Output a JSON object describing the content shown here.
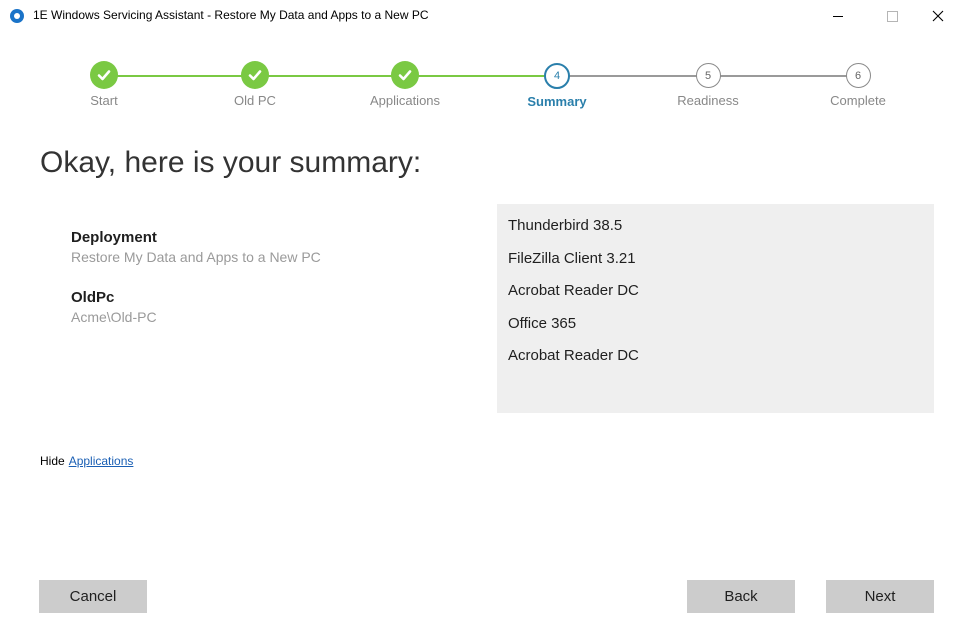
{
  "window": {
    "title": "1E Windows Servicing Assistant - Restore My Data and Apps to a New PC"
  },
  "steps": [
    {
      "label": "Start",
      "number": "1",
      "state": "done"
    },
    {
      "label": "Old PC",
      "number": "2",
      "state": "done"
    },
    {
      "label": "Applications",
      "number": "3",
      "state": "done"
    },
    {
      "label": "Summary",
      "number": "4",
      "state": "current"
    },
    {
      "label": "Readiness",
      "number": "5",
      "state": "todo"
    },
    {
      "label": "Complete",
      "number": "6",
      "state": "todo"
    }
  ],
  "heading": "Okay, here is your summary:",
  "summary": {
    "deployment_label": "Deployment",
    "deployment_value": "Restore My Data and Apps to a New PC",
    "oldpc_label": "OldPc",
    "oldpc_value": "Acme\\Old-PC"
  },
  "applications": [
    "Thunderbird 38.5",
    "FileZilla Client 3.21",
    "Acrobat Reader DC",
    "Office 365",
    "Acrobat Reader DC"
  ],
  "hide_row": {
    "prefix": "Hide",
    "link": "Applications"
  },
  "buttons": {
    "cancel": "Cancel",
    "back": "Back",
    "next": "Next"
  },
  "colors": {
    "step_done": "#7ac943",
    "step_current": "#2a7fab",
    "step_todo": "#9a9a9a",
    "panel_bg": "#efefef",
    "button_bg": "#cccccc",
    "link": "#1a5fb4"
  }
}
